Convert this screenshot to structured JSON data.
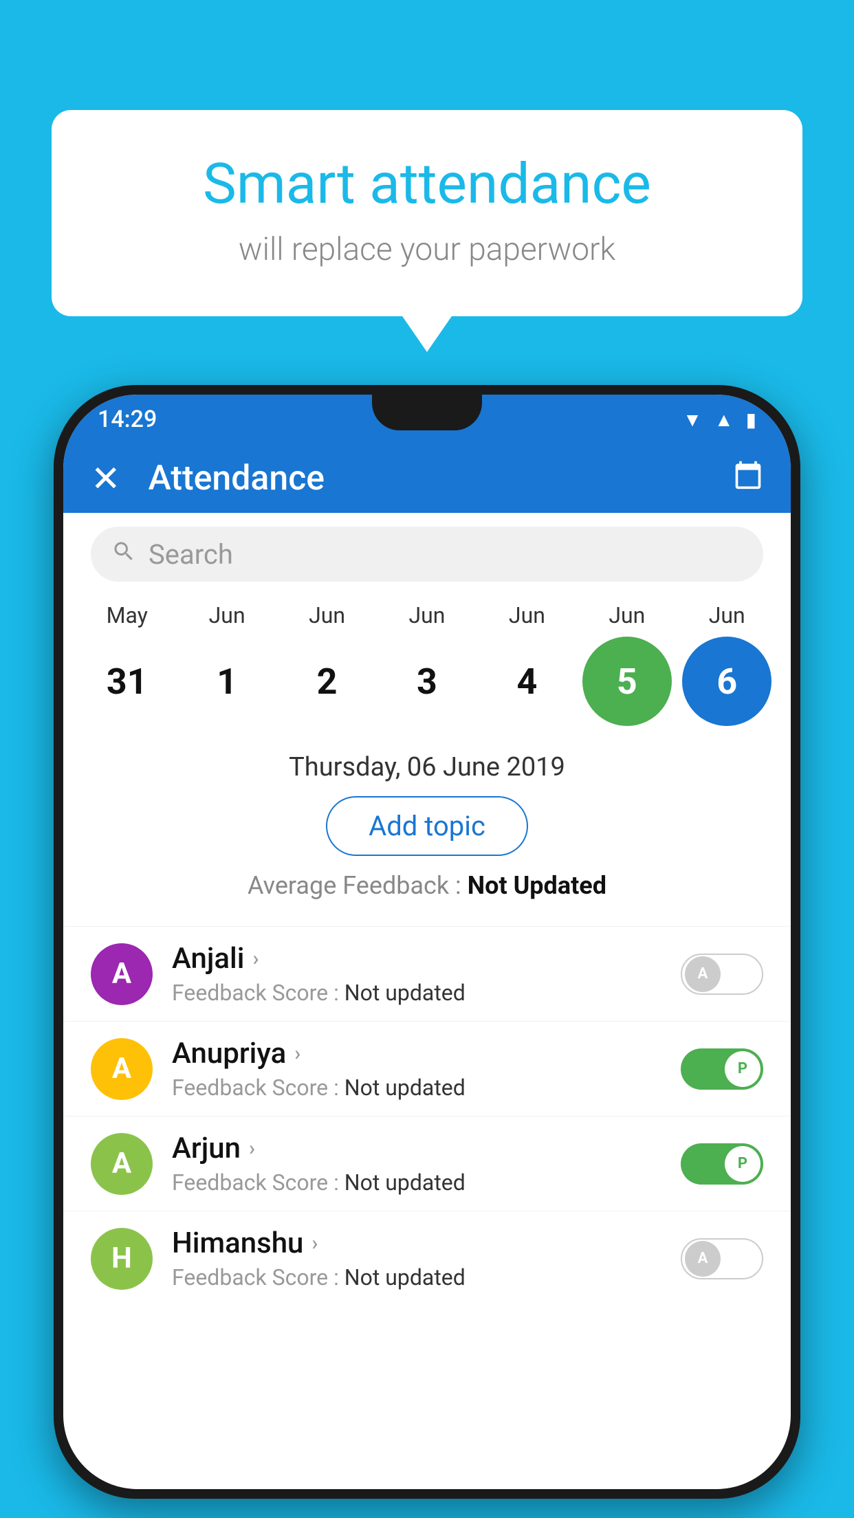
{
  "background_color": "#1ab9e8",
  "bubble": {
    "title": "Smart attendance",
    "subtitle": "will replace your paperwork"
  },
  "phone": {
    "status_bar": {
      "time": "14:29"
    },
    "app_bar": {
      "title": "Attendance",
      "close_label": "✕"
    },
    "search": {
      "placeholder": "Search"
    },
    "calendar": {
      "months": [
        "May",
        "Jun",
        "Jun",
        "Jun",
        "Jun",
        "Jun",
        "Jun"
      ],
      "days": [
        "31",
        "1",
        "2",
        "3",
        "4",
        "5",
        "6"
      ],
      "day_states": [
        "normal",
        "normal",
        "normal",
        "normal",
        "normal",
        "today",
        "selected"
      ],
      "selected_date": "Thursday, 06 June 2019"
    },
    "add_topic_label": "Add topic",
    "avg_feedback_label": "Average Feedback : ",
    "avg_feedback_value": "Not Updated",
    "students": [
      {
        "name": "Anjali",
        "avatar_letter": "A",
        "avatar_color": "#9c27b0",
        "feedback_label": "Feedback Score : ",
        "feedback_value": "Not updated",
        "toggle_state": "off",
        "toggle_letter": "A"
      },
      {
        "name": "Anupriya",
        "avatar_letter": "A",
        "avatar_color": "#ffc107",
        "feedback_label": "Feedback Score : ",
        "feedback_value": "Not updated",
        "toggle_state": "on",
        "toggle_letter": "P"
      },
      {
        "name": "Arjun",
        "avatar_letter": "A",
        "avatar_color": "#8bc34a",
        "feedback_label": "Feedback Score : ",
        "feedback_value": "Not updated",
        "toggle_state": "on",
        "toggle_letter": "P"
      },
      {
        "name": "Himanshu",
        "avatar_letter": "H",
        "avatar_color": "#8bc34a",
        "feedback_label": "Feedback Score : ",
        "feedback_value": "Not updated",
        "toggle_state": "off",
        "toggle_letter": "A"
      }
    ]
  }
}
